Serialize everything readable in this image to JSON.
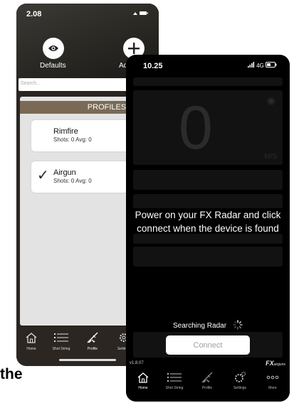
{
  "caption": "the",
  "back_phone": {
    "status": {
      "time": "2.08",
      "icons": "·· ▽ ▬"
    },
    "header": {
      "defaults_label": "Defaults",
      "add_label": "Ad",
      "defaults_icon": "eye-icon",
      "add_icon": "plus-icon"
    },
    "search": {
      "placeholder": "Search..."
    },
    "profiles": {
      "title": "PROFILES",
      "items": [
        {
          "name": "Rimfire",
          "stats": "Shots: 0 Avg: 0",
          "selected": false
        },
        {
          "name": "Airgun",
          "stats": "Shots: 0 Avg: 0",
          "selected": true
        }
      ]
    },
    "tabs": [
      {
        "label": "Home",
        "icon": "home-icon"
      },
      {
        "label": "Shot String",
        "icon": "list-icon"
      },
      {
        "label": "Profile",
        "icon": "rifle-icon",
        "active": true
      },
      {
        "label": "Settings",
        "icon": "gear-icon"
      }
    ]
  },
  "front_phone": {
    "status": {
      "time": "10.25",
      "network": "4G"
    },
    "background": {
      "velocity": "0",
      "unit": "M/S"
    },
    "overlay_message": "Power on your FX Radar and click connect when the device is found",
    "searching_text": "Searching Radar",
    "connect_label": "Connect",
    "version": "v1.8.07",
    "brand": {
      "name": "FX",
      "suffix": "airguns"
    },
    "tabs": [
      {
        "label": "Home",
        "icon": "home-icon",
        "active": true
      },
      {
        "label": "Shot String",
        "icon": "list-icon"
      },
      {
        "label": "Profile",
        "icon": "rifle-icon"
      },
      {
        "label": "Settings",
        "icon": "gear-icon"
      },
      {
        "label": "More",
        "icon": "more-dots-icon"
      }
    ]
  },
  "colors": {
    "profiles_header": "#7a6a55",
    "panel_bg": "#e3e3e3",
    "tabbar_back": "#2b2621",
    "front_bg": "#000000"
  }
}
